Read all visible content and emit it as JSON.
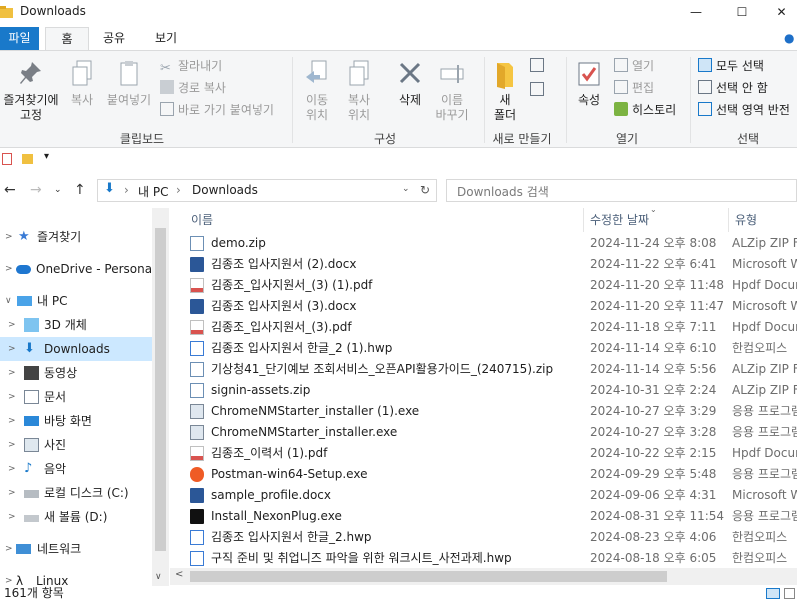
{
  "window": {
    "title": "Downloads",
    "minimize": "—",
    "maximize": "☐",
    "close": "✕"
  },
  "ribbon_tabs": {
    "file": "파일",
    "home": "홈",
    "share": "공유",
    "view": "보기"
  },
  "clipboard": {
    "pin_line1": "즐겨찾기에",
    "pin_line2": "고정",
    "copy": "복사",
    "paste": "붙여넣기",
    "cut": "잘라내기",
    "copy_path": "경로 복사",
    "paste_shortcut": "바로 가기 붙여넣기",
    "group": "클립보드"
  },
  "organize": {
    "move_line1": "이동",
    "move_line2": "위치",
    "copyto_line1": "복사",
    "copyto_line2": "위치",
    "delete": "삭제",
    "rename_line1": "이름",
    "rename_line2": "바꾸기",
    "group": "구성"
  },
  "new": {
    "folder_line1": "새",
    "folder_line2": "폴더",
    "group": "새로 만들기"
  },
  "open": {
    "properties": "속성",
    "open": "열기",
    "edit": "편집",
    "history": "히스토리",
    "group": "열기"
  },
  "select": {
    "all": "모두 선택",
    "none": "선택 안 함",
    "invert": "선택 영역 반전",
    "group": "선택"
  },
  "address": {
    "root": "내 PC",
    "current": "Downloads",
    "sep1": "›",
    "sep2": "›"
  },
  "search": {
    "placeholder": "Downloads 검색"
  },
  "nav": {
    "favorites": "즐겨찾기",
    "onedrive": "OneDrive - Personal",
    "this_pc": "내 PC",
    "objects3d": "3D 개체",
    "downloads": "Downloads",
    "videos": "동영상",
    "documents": "문서",
    "desktop": "바탕 화면",
    "pictures": "사진",
    "music": "음악",
    "local_disk": "로컬 디스크 (C:)",
    "new_volume": "새 볼륨 (D:)",
    "network": "네트워크",
    "linux": "Linux"
  },
  "columns": {
    "name": "이름",
    "date": "수정한 날짜",
    "type": "유형"
  },
  "files": [
    {
      "name": "demo.zip",
      "date": "2024-11-24 오후 8:08",
      "type": "ALZip ZIP File",
      "icon": "zip"
    },
    {
      "name": "김종조 입사지원서 (2).docx",
      "date": "2024-11-22 오후 6:41",
      "type": "Microsoft Word",
      "icon": "docx"
    },
    {
      "name": "김종조_입사지원서_(3) (1).pdf",
      "date": "2024-11-20 오후 11:48",
      "type": "Hpdf Document",
      "icon": "pdf"
    },
    {
      "name": "김종조 입사지원서 (3).docx",
      "date": "2024-11-20 오후 11:47",
      "type": "Microsoft Word",
      "icon": "docx"
    },
    {
      "name": "김종조_입사지원서_(3).pdf",
      "date": "2024-11-18 오후 7:11",
      "type": "Hpdf Document",
      "icon": "pdf"
    },
    {
      "name": "김종조 입사지원서 한글_2 (1).hwp",
      "date": "2024-11-14 오후 6:10",
      "type": "한컴오피스",
      "icon": "hwp"
    },
    {
      "name": "기상청41_단기예보 조회서비스_오픈API활용가이드_(240715).zip",
      "date": "2024-11-14 오후 5:56",
      "type": "ALZip ZIP File",
      "icon": "zip"
    },
    {
      "name": "signin-assets.zip",
      "date": "2024-10-31 오후 2:24",
      "type": "ALZip ZIP File",
      "icon": "zip"
    },
    {
      "name": "ChromeNMStarter_installer (1).exe",
      "date": "2024-10-27 오후 3:29",
      "type": "응용 프로그램",
      "icon": "exe"
    },
    {
      "name": "ChromeNMStarter_installer.exe",
      "date": "2024-10-27 오후 3:28",
      "type": "응용 프로그램",
      "icon": "exe"
    },
    {
      "name": "김종조_이력서 (1).pdf",
      "date": "2024-10-22 오후 2:15",
      "type": "Hpdf Document",
      "icon": "pdf"
    },
    {
      "name": "Postman-win64-Setup.exe",
      "date": "2024-09-29 오후 5:48",
      "type": "응용 프로그램",
      "icon": "postman"
    },
    {
      "name": "sample_profile.docx",
      "date": "2024-09-06 오후 4:31",
      "type": "Microsoft Word",
      "icon": "docx"
    },
    {
      "name": "Install_NexonPlug.exe",
      "date": "2024-08-31 오후 11:54",
      "type": "응용 프로그램",
      "icon": "nexon"
    },
    {
      "name": "김종조 입사지원서 한글_2.hwp",
      "date": "2024-08-23 오후 4:06",
      "type": "한컴오피스",
      "icon": "hwp"
    },
    {
      "name": "구직 준비 및 취업니즈 파악을 위한 워크시트_사전과제.hwp",
      "date": "2024-08-18 오후 6:05",
      "type": "한컴오피스",
      "icon": "hwp"
    }
  ],
  "status": {
    "count": "161개 항목"
  },
  "colors": {
    "accent": "#1979ca",
    "selected": "#cce8ff",
    "folder": "#f0c040"
  }
}
